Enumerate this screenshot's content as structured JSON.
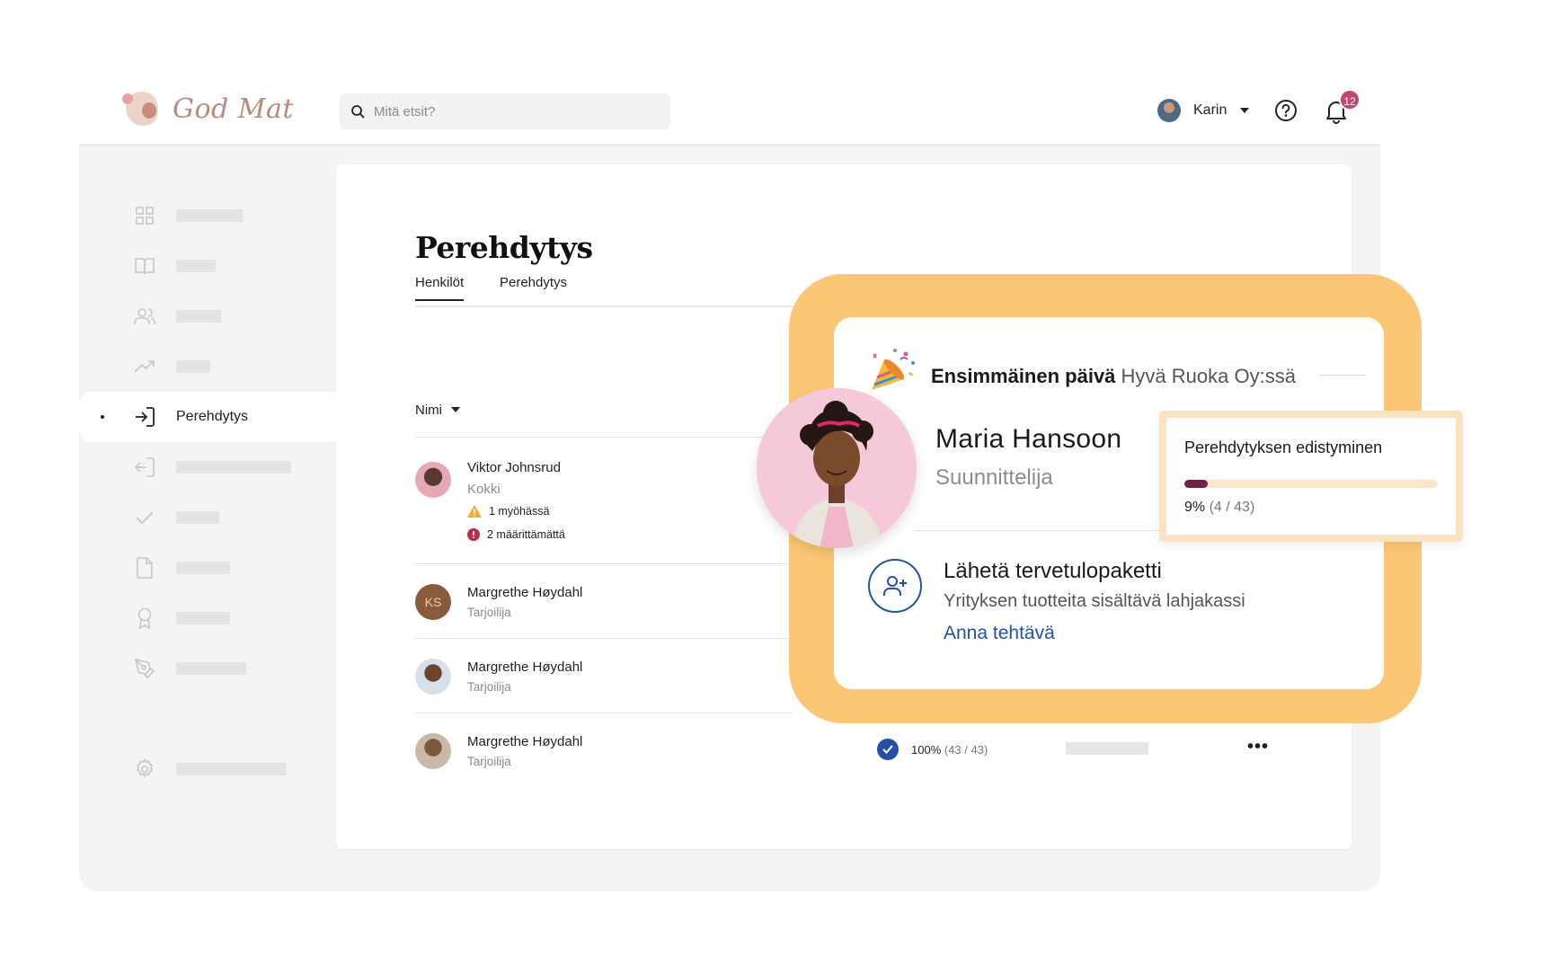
{
  "app": {
    "logo_text": "God Mat",
    "brand_color": "#b98a7f"
  },
  "search": {
    "placeholder": "Mitä etsit?"
  },
  "user": {
    "name": "Karin",
    "notifications": "12"
  },
  "sidebar": {
    "icons": [
      "grid-icon",
      "book-icon",
      "users-icon",
      "trending-icon",
      "login-icon",
      "logout-icon",
      "check-icon",
      "file-icon",
      "award-icon",
      "pen-tool-icon",
      "settings-icon"
    ],
    "active_label": "Perehdytys"
  },
  "page": {
    "title": "Perehdytys",
    "tabs": [
      "Henkilöt",
      "Perehdytys"
    ],
    "sort_label": "Nimi"
  },
  "people": [
    {
      "name": "Viktor Johnsrud",
      "role": "Kokki",
      "status_late": "1 myöhässä",
      "status_undefined": "2 määrittämättä"
    },
    {
      "name": "Margrethe Høydahl",
      "role": "Tarjoilija",
      "initials": "KS"
    },
    {
      "name": "Margrethe Høydahl",
      "role": "Tarjoilija"
    },
    {
      "name": "Margrethe Høydahl",
      "role": "Tarjoilija",
      "progress_pct": "100%",
      "progress_count": "(43 / 43)"
    }
  ],
  "welcome": {
    "title_bold": "Ensimmäinen päivä",
    "title_company": "Hyvä Ruoka Oy:ssä",
    "person_name": "Maria Hansoon",
    "person_role": "Suunnittelija",
    "task_title": "Lähetä tervetulopaketti",
    "task_desc": "Yrityksen tuotteita sisältävä lahjakassi",
    "task_link": "Anna tehtävä"
  },
  "onboarding_progress": {
    "title": "Perehdytyksen edistyminen",
    "percent_label": "9%",
    "count_label": "(4 / 43)",
    "fraction": 0.093
  },
  "colors": {
    "accent": "#2450a6",
    "highlight": "#fcc775",
    "progress": "#6e2046",
    "badge": "#c2466d"
  }
}
